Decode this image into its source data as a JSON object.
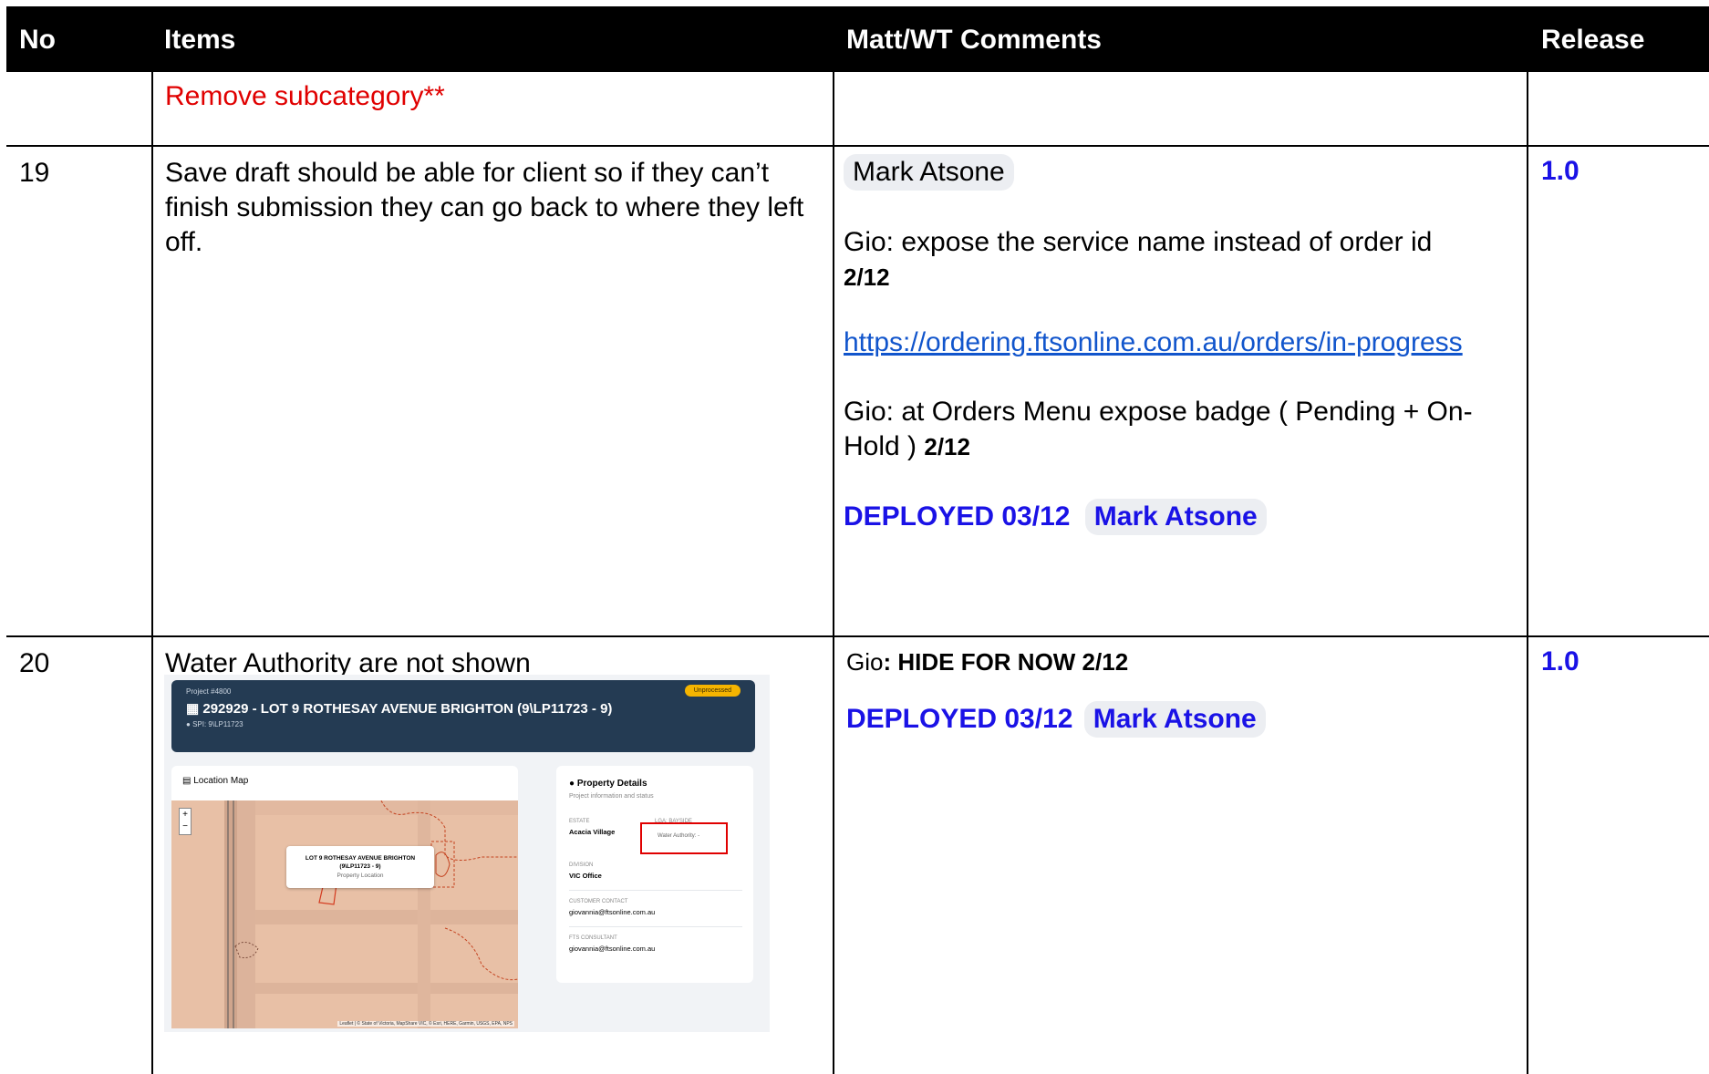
{
  "table": {
    "headers": {
      "no": "No",
      "items": "Items",
      "comments": "Matt/WT Comments",
      "release": "Release"
    }
  },
  "row_top": {
    "item": "Remove subcategory**"
  },
  "row_19": {
    "no": "19",
    "item": "Save draft should be able for client so if they can’t finish submission they can go back to where they left off.",
    "chip_person": "Mark Atsone",
    "comment1": "Gio: expose the service name instead of order id",
    "comment1_date": "2/12",
    "link": "https://ordering.ftsonline.com.au/orders/in-progress",
    "comment2": "Gio: at Orders Menu expose badge ( Pending + On-Hold )",
    "comment2_date": "2/12",
    "deployed": "DEPLOYED 03/12",
    "deployed_person": "Mark Atsone",
    "release": "1.0"
  },
  "row_20": {
    "no": "20",
    "item": "Water Authority are not shown",
    "comment_prefix": "Gio",
    "comment_bold": ": HIDE FOR NOW 2/12",
    "deployed": "DEPLOYED 03/12",
    "deployed_person": "Mark Atsone",
    "release": "1.0"
  },
  "screenshot": {
    "project_label": "Project #4800",
    "title": "292929 - LOT 9 ROTHESAY AVENUE BRIGHTON (9\\LP11723 - 9)",
    "spi": "SPI: 9\\LP11723",
    "status_badge": "Unprocessed",
    "map_heading": "Location Map",
    "popup_line1": "LOT 9 ROTHESAY AVENUE BRIGHTON",
    "popup_line2": "(9\\LP11723 - 9)",
    "popup_line3": "Property Location",
    "attribution": "Leaflet | © State of Victoria, MapShare VIC, © Esri, HERE, Garmin, USGS, EPA, NPS",
    "details_title": "Property Details",
    "details_subtitle": "Project information and status",
    "estate_label": "ESTATE",
    "estate_value": "Acacia Village",
    "lga_label": "LGA: BAYSIDE",
    "water_authority": "Water Authority: -",
    "division_label": "DIVISION",
    "division_value": "VIC Office",
    "customer_label": "CUSTOMER CONTACT",
    "customer_value": "giovannia@ftsonline.com.au",
    "consultant_label": "FTS CONSULTANT",
    "consultant_value": "giovannia@ftsonline.com.au"
  },
  "colors": {
    "accent_blue": "#1a12e6",
    "red": "#e00000",
    "header_bg": "#000000"
  }
}
